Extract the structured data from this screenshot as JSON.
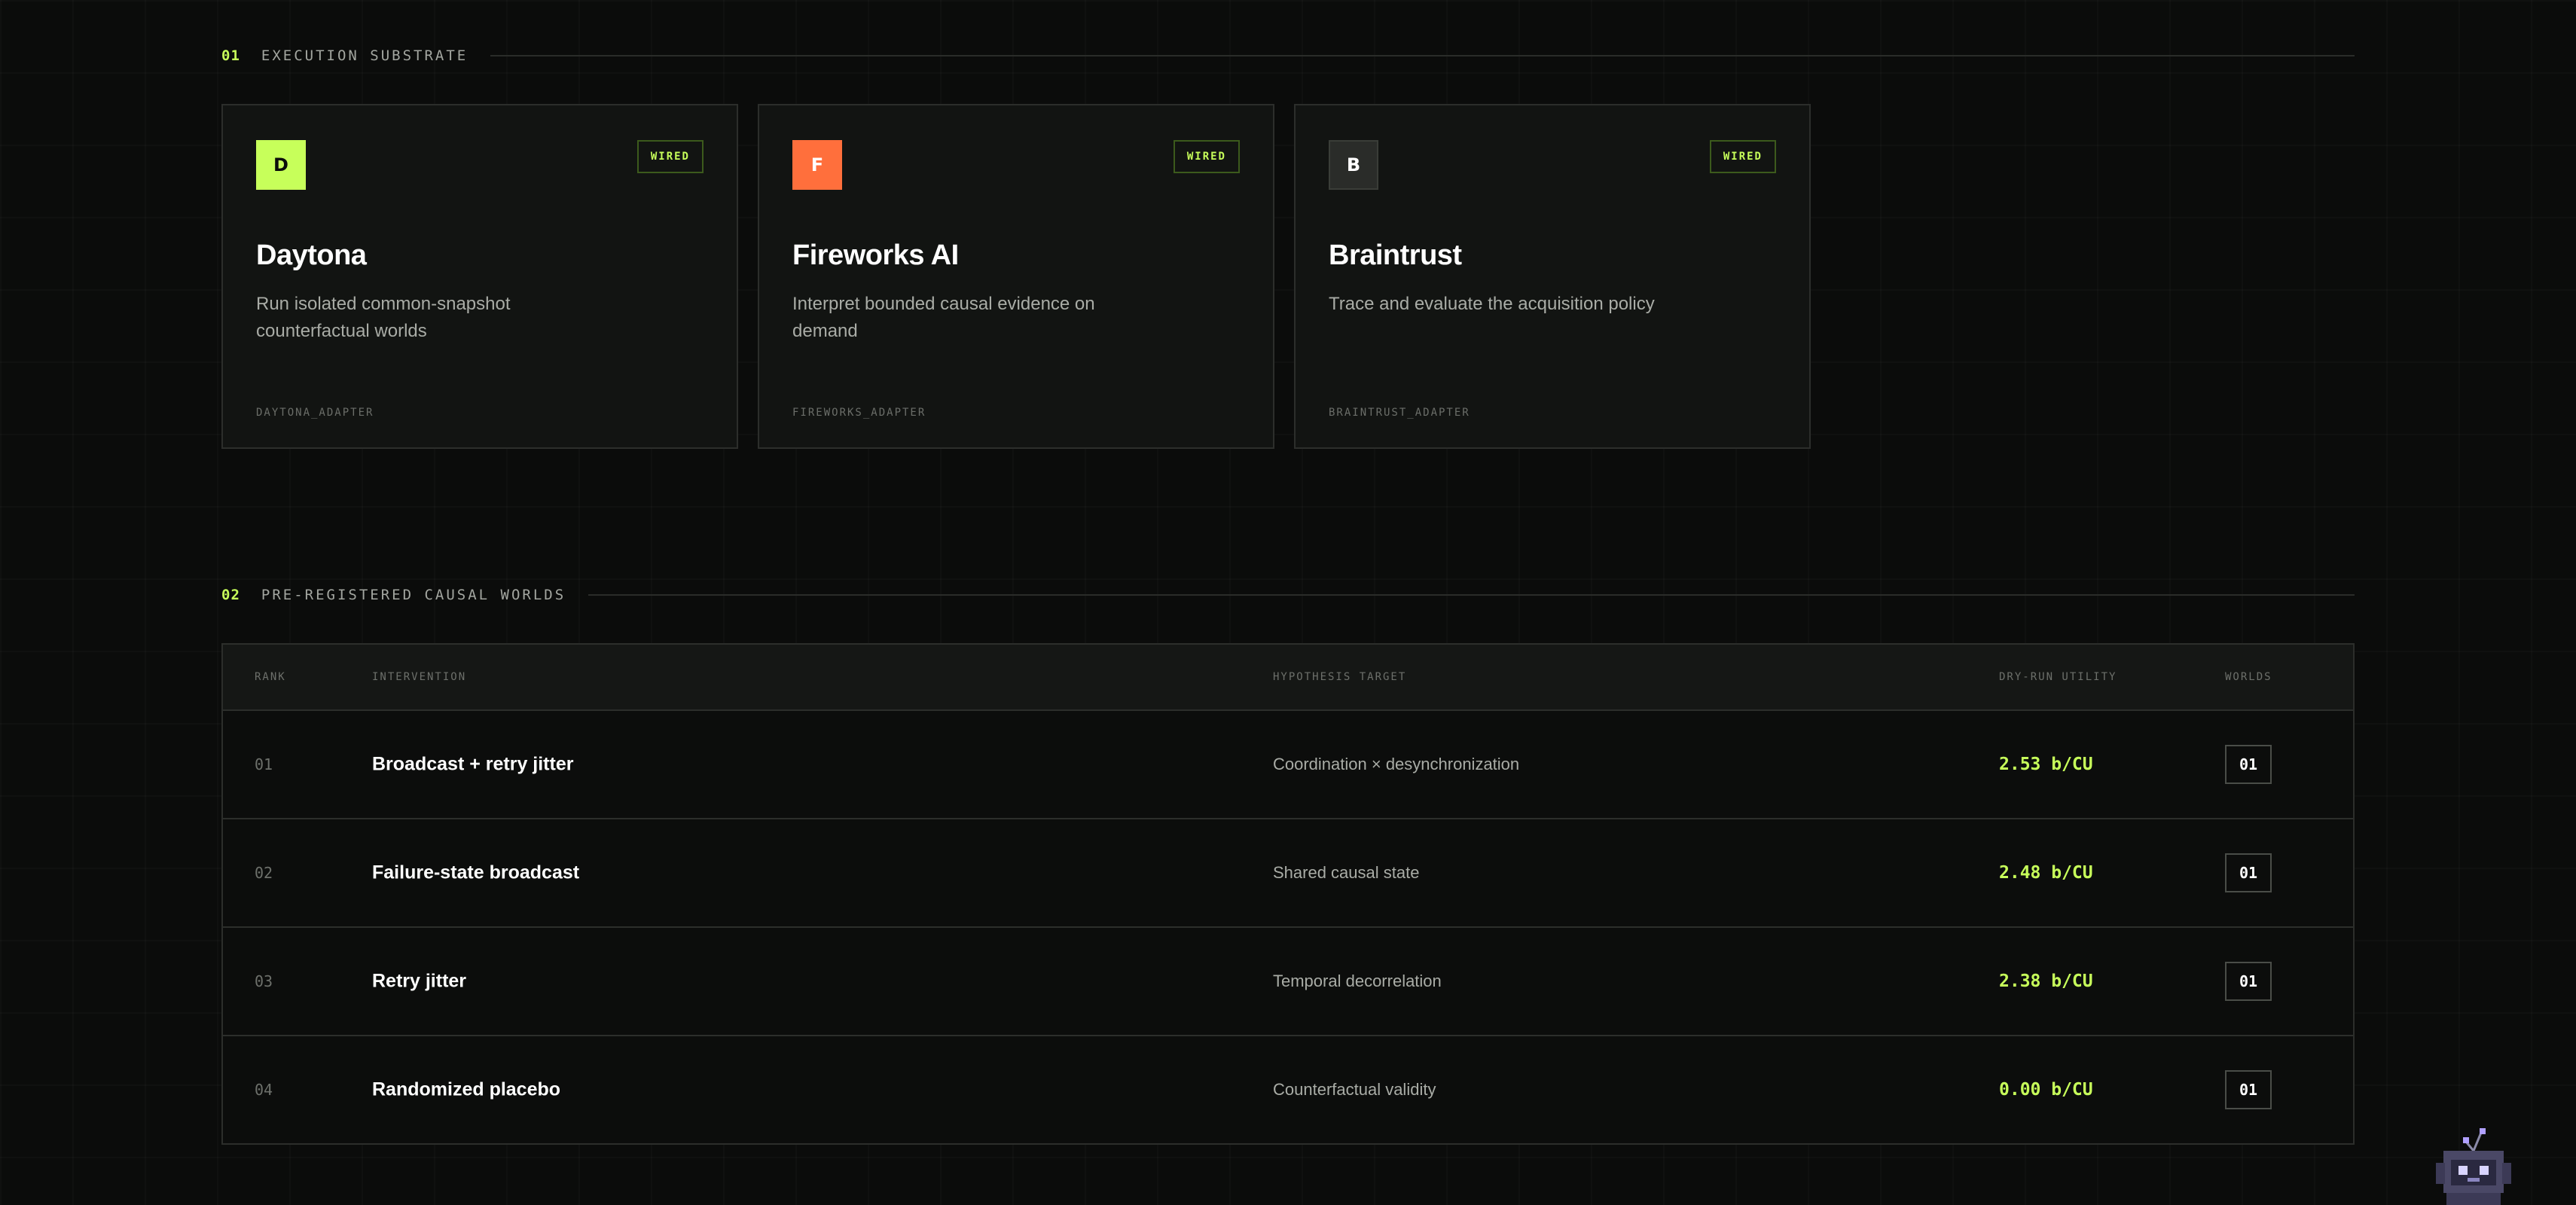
{
  "section1": {
    "num": "01",
    "title": "EXECUTION SUBSTRATE"
  },
  "cards": [
    {
      "logo_letter": "D",
      "logo_bg": "#c7ff5a",
      "logo_fg": "#0b0c0b",
      "badge": "WIRED",
      "title": "Daytona",
      "desc": "Run isolated common-snapshot counterfactual worlds",
      "adapter": "DAYTONA_ADAPTER"
    },
    {
      "logo_letter": "F",
      "logo_bg": "#ff6f3c",
      "logo_fg": "#ffffff",
      "badge": "WIRED",
      "title": "Fireworks AI",
      "desc": "Interpret bounded causal evidence on demand",
      "adapter": "FIREWORKS_ADAPTER"
    },
    {
      "logo_letter": "B",
      "logo_bg": "#2a2c29",
      "logo_fg": "#ffffff",
      "badge": "WIRED",
      "title": "Braintrust",
      "desc": "Trace and evaluate the acquisition policy",
      "adapter": "BRAINTRUST_ADAPTER"
    }
  ],
  "section2": {
    "num": "02",
    "title": "PRE-REGISTERED CAUSAL WORLDS"
  },
  "table": {
    "headers": {
      "rank": "RANK",
      "intervention": "INTERVENTION",
      "hypothesis": "HYPOTHESIS TARGET",
      "utility": "DRY-RUN UTILITY",
      "worlds": "WORLDS"
    },
    "rows": [
      {
        "rank": "01",
        "intervention": "Broadcast + retry jitter",
        "hypothesis": "Coordination × desynchronization",
        "utility": "2.53 b/CU",
        "worlds": "01"
      },
      {
        "rank": "02",
        "intervention": "Failure-state broadcast",
        "hypothesis": "Shared causal state",
        "utility": "2.48 b/CU",
        "worlds": "01"
      },
      {
        "rank": "03",
        "intervention": "Retry jitter",
        "hypothesis": "Temporal decorrelation",
        "utility": "2.38 b/CU",
        "worlds": "01"
      },
      {
        "rank": "04",
        "intervention": "Randomized placebo",
        "hypothesis": "Counterfactual validity",
        "utility": "0.00 b/CU",
        "worlds": "01"
      }
    ]
  },
  "colors": {
    "accent": "#c7ff5a",
    "background": "#0b0c0b",
    "border": "#2c2e2b"
  },
  "icons": {
    "mascot": "robot-mascot-icon"
  }
}
